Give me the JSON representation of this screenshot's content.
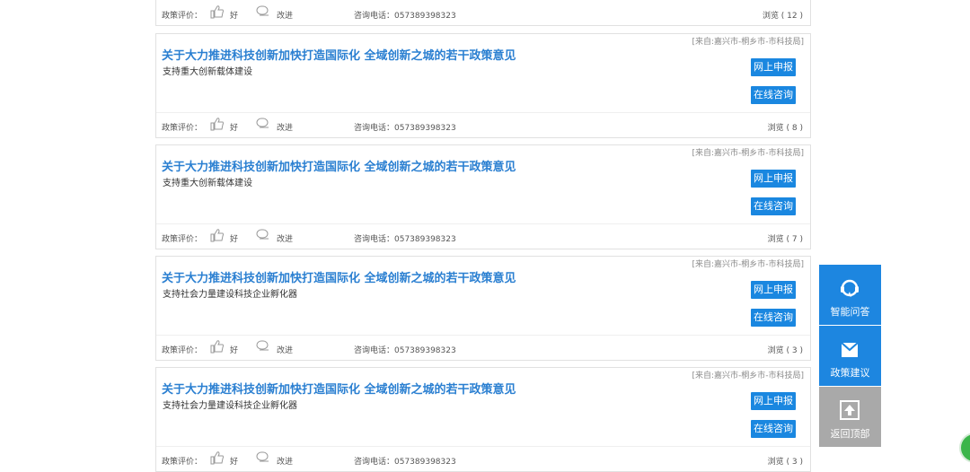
{
  "labels": {
    "rate": "政策评价：",
    "good": "好",
    "improve": "改进",
    "apply": "网上申报",
    "consult": "在线咨询"
  },
  "top_footer": {
    "phone": "咨询电话：057389398323",
    "views": "浏览 ( 12 )"
  },
  "cards": [
    {
      "source": "[来自:嘉兴市-桐乡市-市科技局]",
      "title": "关于大力推进科技创新加快打造国际化 全域创新之城的若干政策意见",
      "subtitle": "支持重大创新载体建设",
      "phone": "咨询电话：057389398323",
      "views": "浏览 ( 8 )"
    },
    {
      "source": "[来自:嘉兴市-桐乡市-市科技局]",
      "title": "关于大力推进科技创新加快打造国际化 全域创新之城的若干政策意见",
      "subtitle": "支持重大创新载体建设",
      "phone": "咨询电话：057389398323",
      "views": "浏览 ( 7 )"
    },
    {
      "source": "[来自:嘉兴市-桐乡市-市科技局]",
      "title": "关于大力推进科技创新加快打造国际化 全域创新之城的若干政策意见",
      "subtitle": "支持社会力量建设科技企业孵化器",
      "phone": "咨询电话：057389398323",
      "views": "浏览 ( 3 )"
    },
    {
      "source": "[来自:嘉兴市-桐乡市-市科技局]",
      "title": "关于大力推进科技创新加快打造国际化 全域创新之城的若干政策意见",
      "subtitle": "支持社会力量建设科技企业孵化器",
      "phone": "咨询电话：057389398323",
      "views": "浏览 ( 3 )"
    }
  ],
  "sidebar": {
    "qa": "智能问答",
    "suggest": "政策建议",
    "top": "返回顶部"
  },
  "colors": {
    "accent": "#1a87e0",
    "title": "#2a7fd1",
    "gray_btn": "#a9a9a9"
  }
}
